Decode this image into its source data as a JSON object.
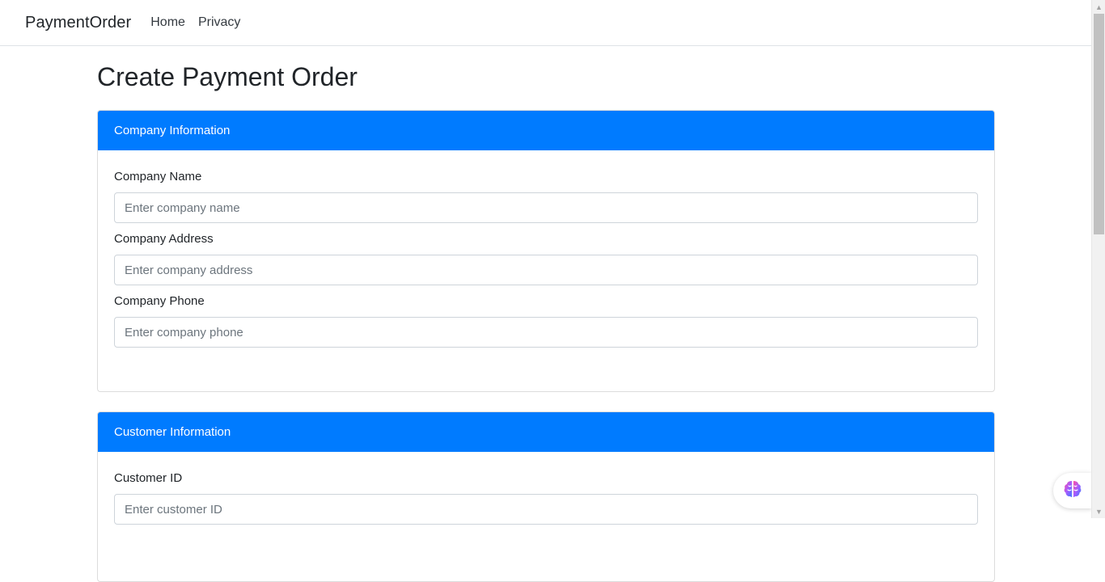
{
  "navbar": {
    "brand": "PaymentOrder",
    "links": [
      "Home",
      "Privacy"
    ]
  },
  "page": {
    "title": "Create Payment Order"
  },
  "company_section": {
    "header": "Company Information",
    "fields": [
      {
        "label": "Company Name",
        "placeholder": "Enter company name",
        "value": ""
      },
      {
        "label": "Company Address",
        "placeholder": "Enter company address",
        "value": ""
      },
      {
        "label": "Company Phone",
        "placeholder": "Enter company phone",
        "value": ""
      }
    ]
  },
  "customer_section": {
    "header": "Customer Information",
    "fields": [
      {
        "label": "Customer ID",
        "placeholder": "Enter customer ID",
        "value": ""
      }
    ]
  },
  "floating": {
    "icon": "brain-icon"
  },
  "colors": {
    "accent": "#007bff",
    "card_header_text": "#ffffff",
    "text": "#212529"
  }
}
